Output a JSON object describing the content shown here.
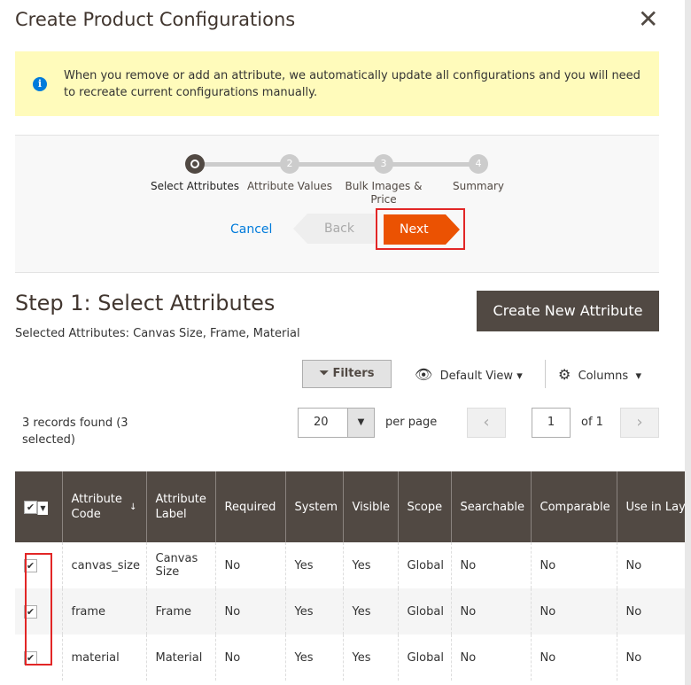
{
  "modal": {
    "title": "Create Product Configurations",
    "close_icon": "close-icon"
  },
  "notice": {
    "text": "When you remove or add an attribute, we automatically update all configurations and you will need to recreate current configurations manually.",
    "icon": "i"
  },
  "wizard": {
    "steps": [
      {
        "num": "",
        "label": "Select Attributes",
        "active": true
      },
      {
        "num": "2",
        "label": "Attribute Values"
      },
      {
        "num": "3",
        "label": "Bulk Images & Price"
      },
      {
        "num": "4",
        "label": "Summary"
      }
    ],
    "cancel": "Cancel",
    "back": "Back",
    "next": "Next"
  },
  "step": {
    "title": "Step 1: Select Attributes",
    "selected": "Selected Attributes: Canvas Size, Frame, Material",
    "create_button": "Create New Attribute"
  },
  "toolbar": {
    "filters": "Filters",
    "view": "Default View",
    "columns": "Columns",
    "records": "3 records found (3 selected)",
    "per_page_value": "20",
    "per_page_label": "per page",
    "page": "1",
    "of": "of 1"
  },
  "table": {
    "headers": [
      "Attribute Code",
      "Attribute Label",
      "Required",
      "System",
      "Visible",
      "Scope",
      "Searchable",
      "Comparable",
      "Use in Layered Navigation"
    ],
    "rows": [
      [
        "canvas_size",
        "Canvas Size",
        "No",
        "Yes",
        "Yes",
        "Global",
        "No",
        "No",
        "No"
      ],
      [
        "frame",
        "Frame",
        "No",
        "Yes",
        "Yes",
        "Global",
        "No",
        "No",
        "No"
      ],
      [
        "material",
        "Material",
        "No",
        "Yes",
        "Yes",
        "Global",
        "No",
        "No",
        "No"
      ]
    ]
  },
  "colors": {
    "accent": "#eb5202",
    "header": "#514943",
    "notice": "#fffbbb",
    "link": "#007bdb",
    "highlight": "#e22626"
  }
}
